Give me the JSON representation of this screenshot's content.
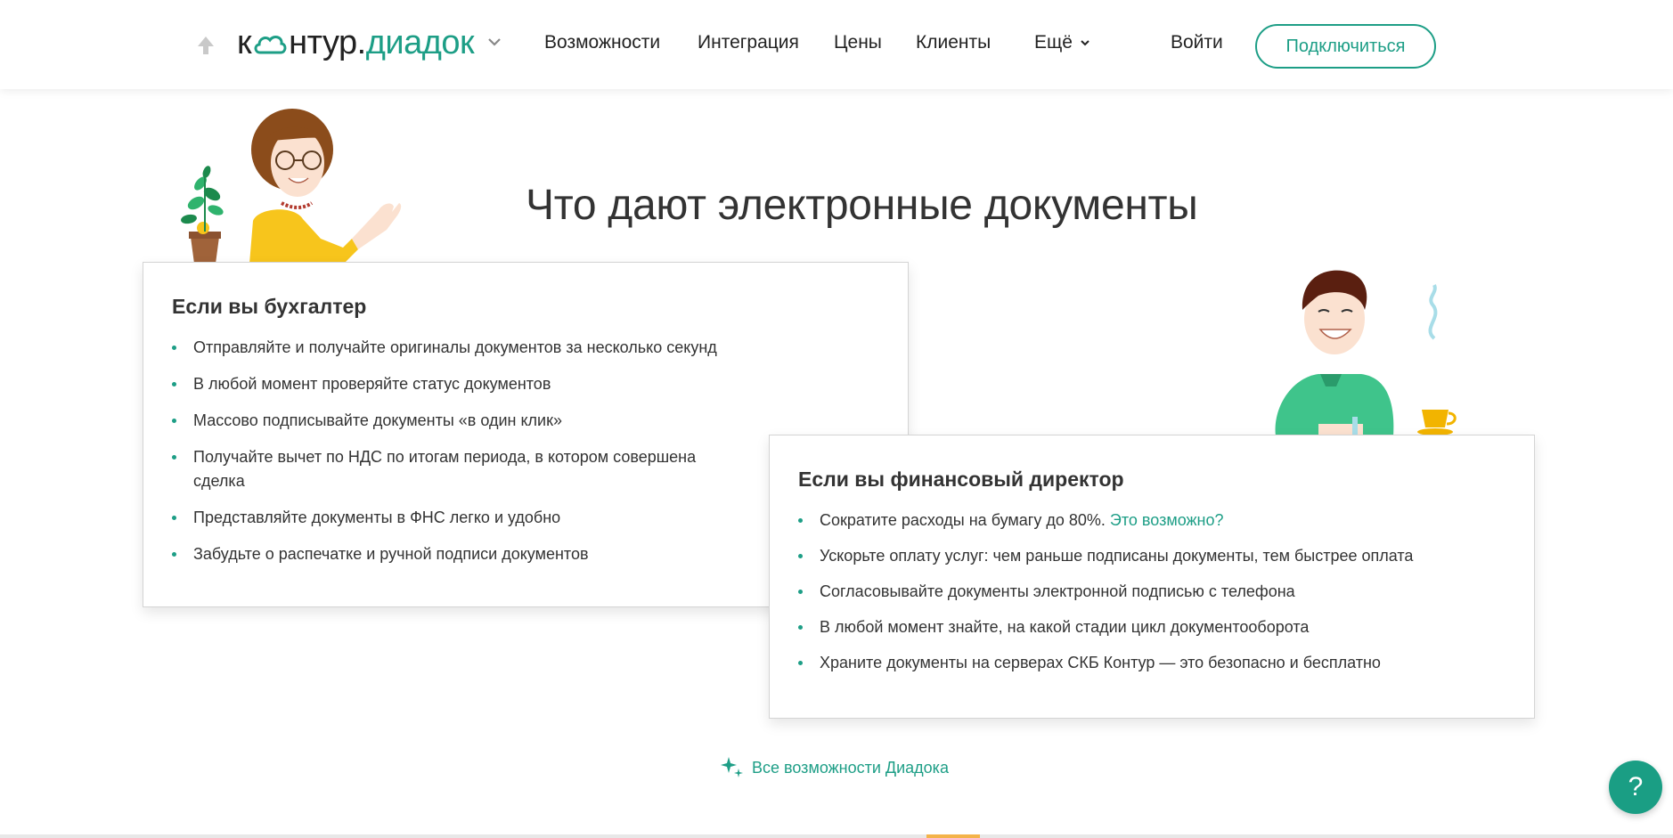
{
  "header": {
    "logo_main": "к",
    "logo_main2": "нтур.",
    "logo_accent": "диадок",
    "nav": [
      {
        "label": "Возможности"
      },
      {
        "label": "Интеграция"
      },
      {
        "label": "Цены"
      },
      {
        "label": "Клиенты"
      },
      {
        "label": "Ещё"
      }
    ],
    "login": "Войти",
    "connect": "Подключиться"
  },
  "main": {
    "title": "Что дают электронные документы",
    "accountant": {
      "heading": "Если вы бухгалтер",
      "items": [
        "Отправляйте и получайте оригиналы документов за несколько секунд",
        "В любой момент проверяйте статус документов",
        "Массово подписывайте документы «в один клик»",
        "Получайте вычет по НДС по итогам периода, в котором совершена сделка",
        "Представляйте документы в ФНС легко и удобно",
        "Забудьте о распечатке и ручной подписи документов"
      ]
    },
    "director": {
      "heading": "Если вы финансовый директор",
      "item1_text": "Сократите расходы на бумагу до 80%.",
      "item1_link": "Это возможно?",
      "items": [
        "Ускорьте оплату услуг: чем раньше подписаны документы, тем быстрее оплата",
        "Согласовывайте документы электронной подписью с телефона",
        "В любой момент знайте, на какой стадии цикл документооборота",
        "Храните документы на серверах СКБ Контур — это безопасно и бесплатно"
      ]
    },
    "all_features": "Все возможности Диадока"
  },
  "help": "?",
  "colors": {
    "accent": "#1d9e86",
    "text": "#333333",
    "yellow": "#f7c51c"
  },
  "icons": [
    "up-arrow-icon",
    "cloud-icon",
    "chevron-down-icon",
    "sparkle-icon",
    "question-icon"
  ]
}
